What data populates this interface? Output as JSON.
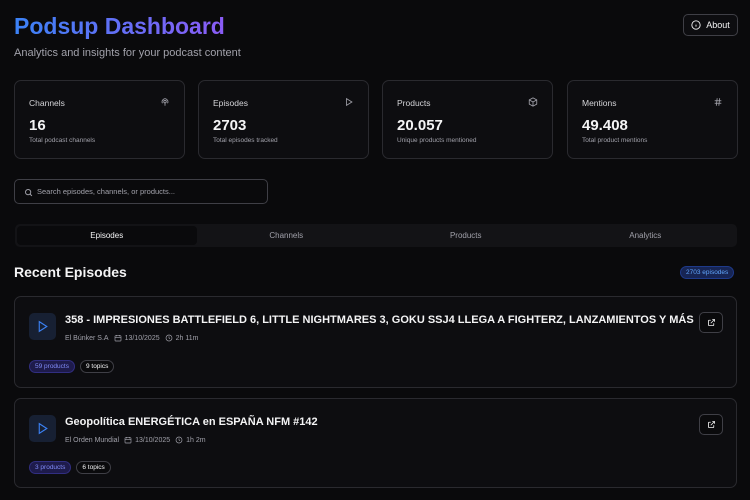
{
  "header": {
    "title": "Podsup Dashboard",
    "subtitle": "Analytics and insights for your podcast content",
    "about_label": "About"
  },
  "stats": [
    {
      "label": "Channels",
      "value": "16",
      "description": "Total podcast channels",
      "icon": "podcast-icon"
    },
    {
      "label": "Episodes",
      "value": "2703",
      "description": "Total episodes tracked",
      "icon": "play-icon"
    },
    {
      "label": "Products",
      "value": "20.057",
      "description": "Unique products mentioned",
      "icon": "package-icon"
    },
    {
      "label": "Mentions",
      "value": "49.408",
      "description": "Total product mentions",
      "icon": "hash-icon"
    }
  ],
  "search": {
    "placeholder": "Search episodes, channels, or products...",
    "value": ""
  },
  "tabs": [
    {
      "label": "Episodes",
      "active": true
    },
    {
      "label": "Channels",
      "active": false
    },
    {
      "label": "Products",
      "active": false
    },
    {
      "label": "Analytics",
      "active": false
    }
  ],
  "recent": {
    "title": "Recent Episodes",
    "count_label": "2703 episodes"
  },
  "episodes": [
    {
      "title": "358 - IMPRESIONES BATTLEFIELD 6, LITTLE NIGHTMARES 3, GOKU SSJ4 LLEGA A FIGHTERZ, LANZAMIENTOS Y MÁS",
      "channel": "El Búnker S.A",
      "date": "13/10/2025",
      "duration": "2h 11m",
      "products": "59 products",
      "topics": "9 topics"
    },
    {
      "title": "Geopolítica ENERGÉTICA en ESPAÑA NFM #142",
      "channel": "El Orden Mundial",
      "date": "13/10/2025",
      "duration": "1h 2m",
      "products": "3 products",
      "topics": "6 topics"
    }
  ],
  "colors": {
    "accent_blue": "#3b82f6",
    "accent_purple": "#8b5cf6",
    "background": "#0a0a0c"
  }
}
